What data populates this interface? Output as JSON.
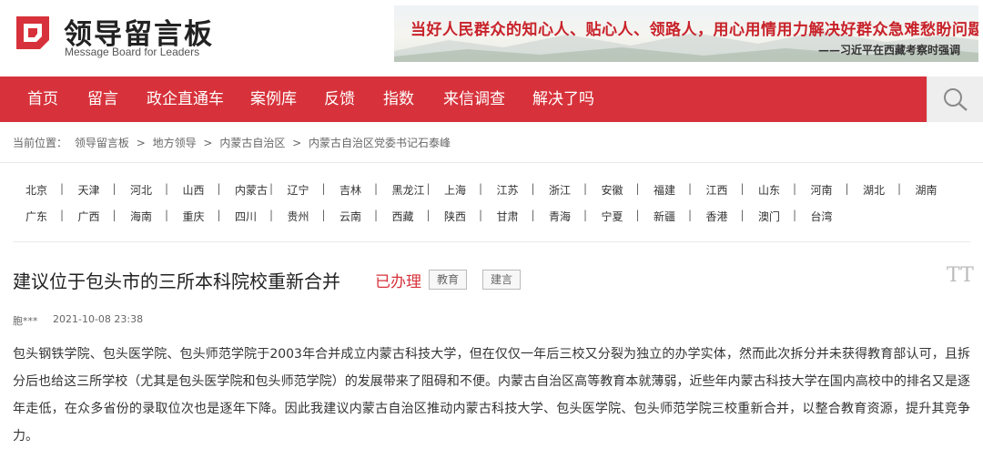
{
  "header": {
    "logo_title": "领导留言板",
    "logo_subtitle": "Message Board for Leaders",
    "banner_quote": "当好人民群众的知心人、贴心人、领路人，用心用情用力解决好群众急难愁盼问题。",
    "banner_source": "——习近平在西藏考察时强调",
    "colors": {
      "brand_red": "#d7323b",
      "banner_text": "#c8222a"
    }
  },
  "nav": {
    "items": [
      "首页",
      "留言",
      "政企直通车",
      "案例库",
      "反馈",
      "指数",
      "来信调查",
      "解决了吗"
    ],
    "search_icon": "search-icon"
  },
  "breadcrumb": {
    "prefix": "当前位置：",
    "items": [
      "领导留言板",
      "地方领导",
      "内蒙古自治区",
      "内蒙古自治区党委书记石泰峰"
    ],
    "separator": ">"
  },
  "regions": {
    "row1": [
      "北京",
      "天津",
      "河北",
      "山西",
      "内蒙古",
      "辽宁",
      "吉林",
      "黑龙江",
      "上海",
      "江苏",
      "浙江",
      "安徽",
      "福建",
      "江西",
      "山东",
      "河南",
      "湖北",
      "湖南"
    ],
    "row2": [
      "广东",
      "广西",
      "海南",
      "重庆",
      "四川",
      "贵州",
      "云南",
      "西藏",
      "陕西",
      "甘肃",
      "青海",
      "宁夏",
      "新疆",
      "香港",
      "澳门",
      "台湾"
    ],
    "separator": "|"
  },
  "article": {
    "title": "建议位于包头市的三所本科院校重新合并",
    "status": "已办理",
    "tags": [
      "教育",
      "建言"
    ],
    "font_icon": "TT",
    "author": "胞***",
    "datetime": "2021-10-08 23:38",
    "body": "包头钢铁学院、包头医学院、包头师范学院于2003年合并成立内蒙古科技大学，但在仅仅一年后三校又分裂为独立的办学实体，然而此次拆分并未获得教育部认可，且拆分后也给这三所学校（尤其是包头医学院和包头师范学院）的发展带来了阻碍和不便。内蒙古自治区高等教育本就薄弱，近些年内蒙古科技大学在国内高校中的排名又是逐年走低，在众多省份的录取位次也是逐年下降。因此我建议内蒙古自治区推动内蒙古科技大学、包头医学院、包头师范学院三校重新合并，以整合教育资源，提升其竞争力。"
  }
}
